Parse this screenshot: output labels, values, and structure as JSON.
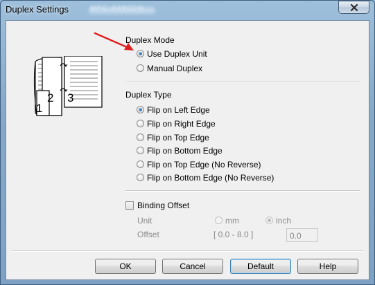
{
  "window": {
    "title": "Duplex Settings",
    "blurred_title": "MFC-8480DN"
  },
  "illustration": {
    "page_numbers": [
      "1",
      "2",
      "3"
    ]
  },
  "duplex_mode": {
    "heading": "Duplex Mode",
    "options": [
      {
        "label": "Use Duplex Unit",
        "selected": true
      },
      {
        "label": "Manual Duplex",
        "selected": false
      }
    ]
  },
  "duplex_type": {
    "heading": "Duplex Type",
    "options": [
      {
        "label": "Flip on Left Edge",
        "selected": true
      },
      {
        "label": "Flip on Right Edge",
        "selected": false
      },
      {
        "label": "Flip on Top Edge",
        "selected": false
      },
      {
        "label": "Flip on Bottom Edge",
        "selected": false
      },
      {
        "label": "Flip on Top Edge (No Reverse)",
        "selected": false
      },
      {
        "label": "Flip on Bottom Edge (No Reverse)",
        "selected": false
      }
    ]
  },
  "binding_offset": {
    "label": "Binding Offset",
    "checked": false,
    "unit_label": "Unit",
    "unit_options": [
      {
        "label": "mm",
        "selected": false
      },
      {
        "label": "inch",
        "selected": true
      }
    ],
    "offset_label": "Offset",
    "offset_range": "[ 0.0 - 8.0 ]",
    "offset_value": "0.0"
  },
  "buttons": {
    "ok": "OK",
    "cancel": "Cancel",
    "default": "Default",
    "help": "Help"
  },
  "colors": {
    "arrow": "#e02020",
    "title_bar": "#8fb1cf",
    "dialog_bg": "#f0f0f0"
  }
}
